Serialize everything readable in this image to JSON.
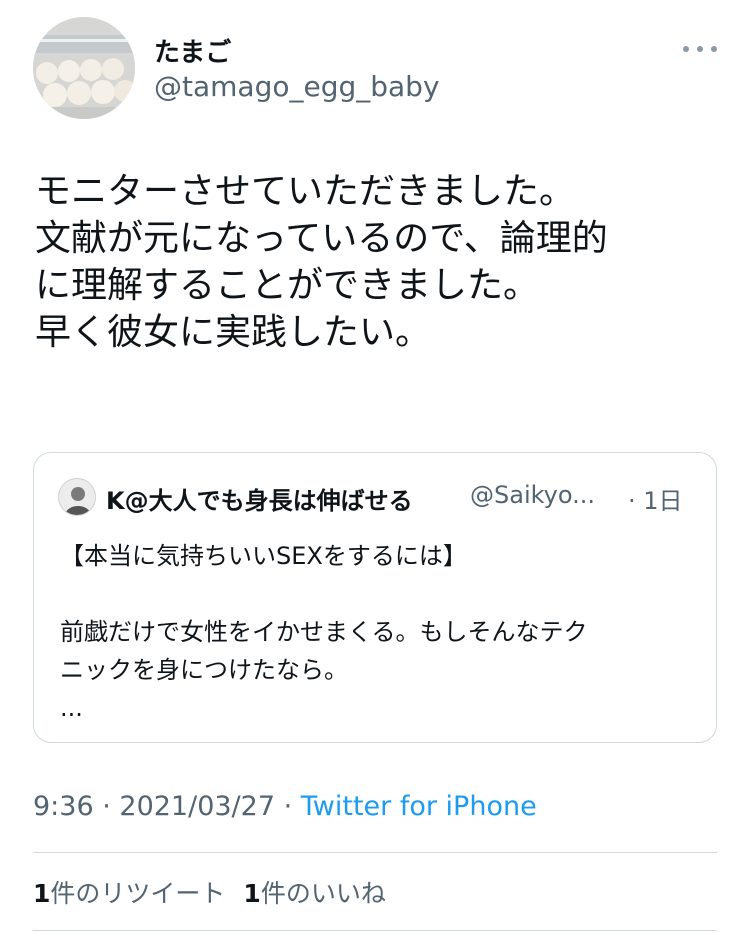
{
  "author": {
    "name": "たまご",
    "handle": "@tamago_egg_baby"
  },
  "tweet": {
    "lines": [
      "モニターさせていただきました。",
      "文献が元になっているので、論理的",
      "に理解することができました。",
      "早く彼女に実践したい。"
    ]
  },
  "quote": {
    "name": "K@大人でも身長は伸ばせる",
    "handle": "@Saikyo...",
    "date": "· 1日",
    "lines": [
      "【本当に気持ちいいSEXをするには】",
      "",
      "前戯だけで女性をイかせまくる。もしそんなテク",
      "ニックを身につけたなら。",
      "..."
    ]
  },
  "meta": {
    "time": "9:36",
    "sep1": " · ",
    "date": "2021/03/27",
    "sep2": " · ",
    "source": "Twitter for iPhone"
  },
  "stats": {
    "retweet_count": "1",
    "retweet_label": "件のリツイート",
    "like_count": "1",
    "like_label": "件のいいね"
  },
  "icons": {
    "more": "more-horizontal-icon"
  },
  "colors": {
    "link": "#1d9bf0",
    "secondary_text": "#536471",
    "border": "#cfd9de"
  }
}
